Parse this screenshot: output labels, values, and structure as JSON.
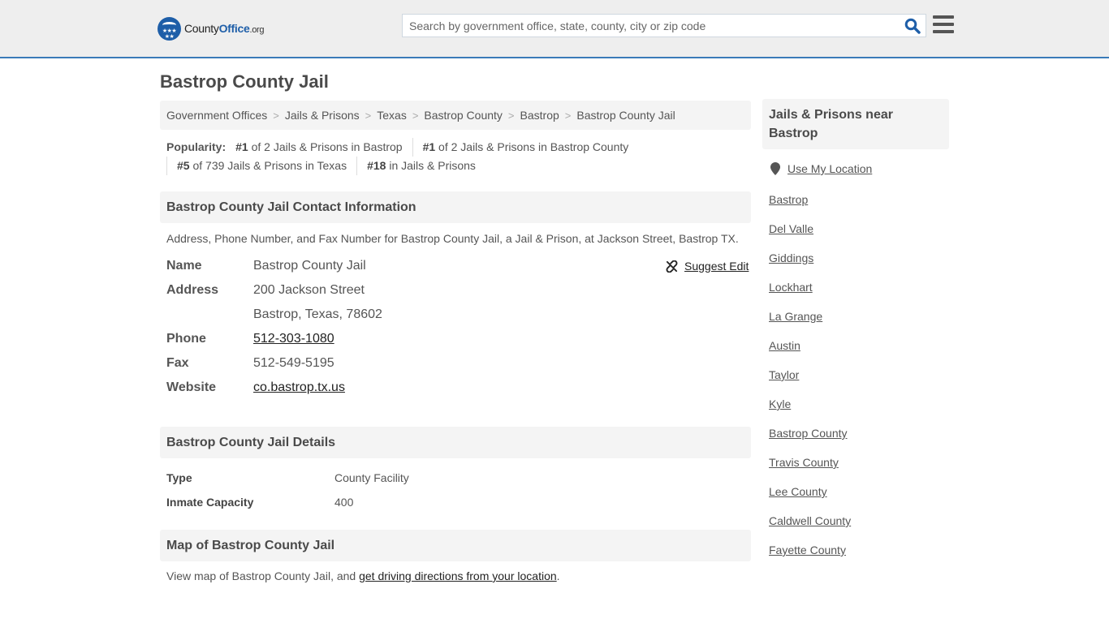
{
  "header": {
    "logo": {
      "brand_prefix": "County",
      "brand_main": "Office",
      "brand_suffix": ".org",
      "stars": "★★★\n★★"
    },
    "search": {
      "placeholder": "Search by government office, state, county, city or zip code",
      "value": ""
    },
    "icons": {
      "search": "search-icon",
      "menu": "hamburger-menu-icon"
    },
    "accent_color": "#3a7ab8",
    "brand_color": "#1e5ea8"
  },
  "page": {
    "title": "Bastrop County Jail"
  },
  "breadcrumb": [
    {
      "label": "Government Offices"
    },
    {
      "label": "Jails & Prisons"
    },
    {
      "label": "Texas"
    },
    {
      "label": "Bastrop County"
    },
    {
      "label": "Bastrop"
    },
    {
      "label": "Bastrop County Jail"
    }
  ],
  "breadcrumb_separator": ">",
  "popularity": {
    "label": "Popularity:",
    "items": [
      {
        "rank": "#1",
        "text": " of 2 Jails & Prisons in Bastrop"
      },
      {
        "rank": "#1",
        "text": " of 2 Jails & Prisons in Bastrop County"
      },
      {
        "rank": "#5",
        "text": " of 739 Jails & Prisons in Texas"
      },
      {
        "rank": "#18",
        "text": " in Jails & Prisons"
      }
    ]
  },
  "contact": {
    "heading": "Bastrop County Jail Contact Information",
    "description": "Address, Phone Number, and Fax Number for Bastrop County Jail, a Jail & Prison, at Jackson Street, Bastrop TX.",
    "suggest_edit": "Suggest Edit",
    "rows": {
      "name": {
        "label": "Name",
        "value": "Bastrop County Jail"
      },
      "address": {
        "label": "Address",
        "line1": "200 Jackson Street",
        "line2": "Bastrop, Texas, 78602"
      },
      "phone": {
        "label": "Phone",
        "value": "512-303-1080"
      },
      "fax": {
        "label": "Fax",
        "value": "512-549-5195"
      },
      "website": {
        "label": "Website",
        "value": "co.bastrop.tx.us"
      }
    }
  },
  "details": {
    "heading": "Bastrop County Jail Details",
    "rows": [
      {
        "label": "Type",
        "value": "County Facility"
      },
      {
        "label": "Inmate Capacity",
        "value": "400"
      }
    ]
  },
  "map": {
    "heading": "Map of Bastrop County Jail",
    "text_before": "View map of Bastrop County Jail, and ",
    "link": "get driving directions from your location",
    "text_after": "."
  },
  "sidebar": {
    "heading": "Jails & Prisons near Bastrop",
    "use_location": "Use My Location",
    "links": [
      "Bastrop",
      "Del Valle",
      "Giddings",
      "Lockhart",
      "La Grange",
      "Austin",
      "Taylor",
      "Kyle",
      "Bastrop County",
      "Travis County",
      "Lee County",
      "Caldwell County",
      "Fayette County"
    ]
  }
}
